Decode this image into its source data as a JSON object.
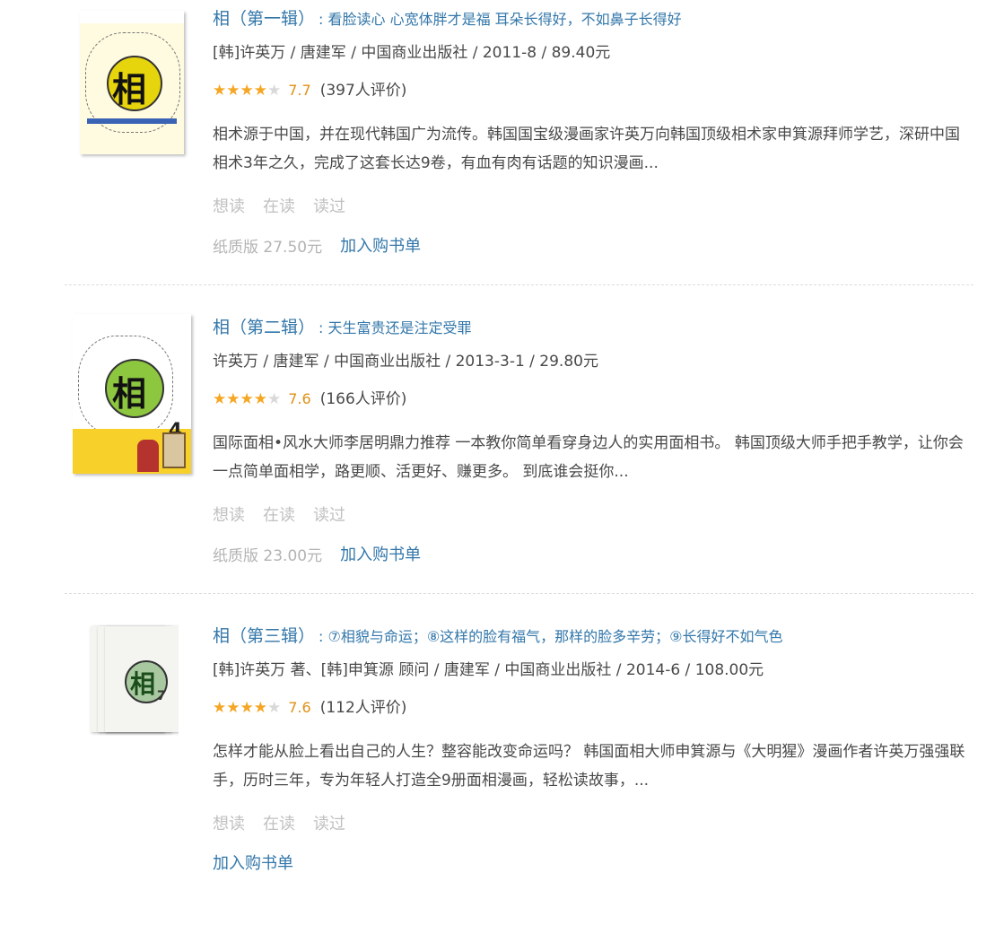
{
  "books": [
    {
      "title": "相（第一辑）",
      "subtitle": ": 看脸读心 心宽体胖才是福 耳朵长得好，不如鼻子长得好",
      "pub": "[韩]许英万 / 唐建军 / 中国商业出版社 / 2011-8 / 89.40元",
      "rating": 3.5,
      "score": "7.7",
      "count": "(397人评价)",
      "desc": "相术源于中国，并在现代韩国广为流传。韩国国宝级漫画家许英万向韩国顶级相术家申箕源拜师学艺，深研中国相术3年之久，完成了这套长达9卷，有血有肉有话题的知识漫画...",
      "actions": [
        "想读",
        "在读",
        "读过"
      ],
      "price": "纸质版 27.50元",
      "cart": "加入购书单",
      "cover_icon": "book-cover-vol1"
    },
    {
      "title": "相（第二辑）",
      "subtitle": ": 天生富贵还是注定受罪",
      "pub": "许英万 / 唐建军 / 中国商业出版社 / 2013-3-1 / 29.80元",
      "rating": 3.5,
      "score": "7.6",
      "count": "(166人评价)",
      "desc": "国际面相•风水大师李居明鼎力推荐 一本教你简单看穿身边人的实用面相书。 韩国顶级大师手把手教学，让你会一点简单面相学，路更顺、活更好、赚更多。 到底谁会挺你...",
      "actions": [
        "想读",
        "在读",
        "读过"
      ],
      "price": "纸质版 23.00元",
      "cart": "加入购书单",
      "cover_icon": "book-cover-vol2"
    },
    {
      "title": "相（第三辑）",
      "subtitle": ": ⑦相貌与命运；⑧这样的脸有福气，那样的脸多辛劳；⑨长得好不如气色",
      "pub": "[韩]许英万 著、[韩]申箕源 顾问 / 唐建军 / 中国商业出版社 / 2014-6 / 108.00元",
      "rating": 3.5,
      "score": "7.6",
      "count": "(112人评价)",
      "desc": "怎样才能从脸上看出自己的人生？整容能改变命运吗？ 韩国面相大师申箕源与《大明猩》漫画作者许英万强强联手，历时三年，专为年轻人打造全9册面相漫画，轻松读故事，...",
      "actions": [
        "想读",
        "在读",
        "读过"
      ],
      "price": "",
      "cart": "加入购书单",
      "cover_icon": "book-cover-vol3"
    }
  ],
  "colors": {
    "link": "#3377aa",
    "star": "#f5a623",
    "score": "#e09015",
    "muted": "#c0c0c0"
  }
}
